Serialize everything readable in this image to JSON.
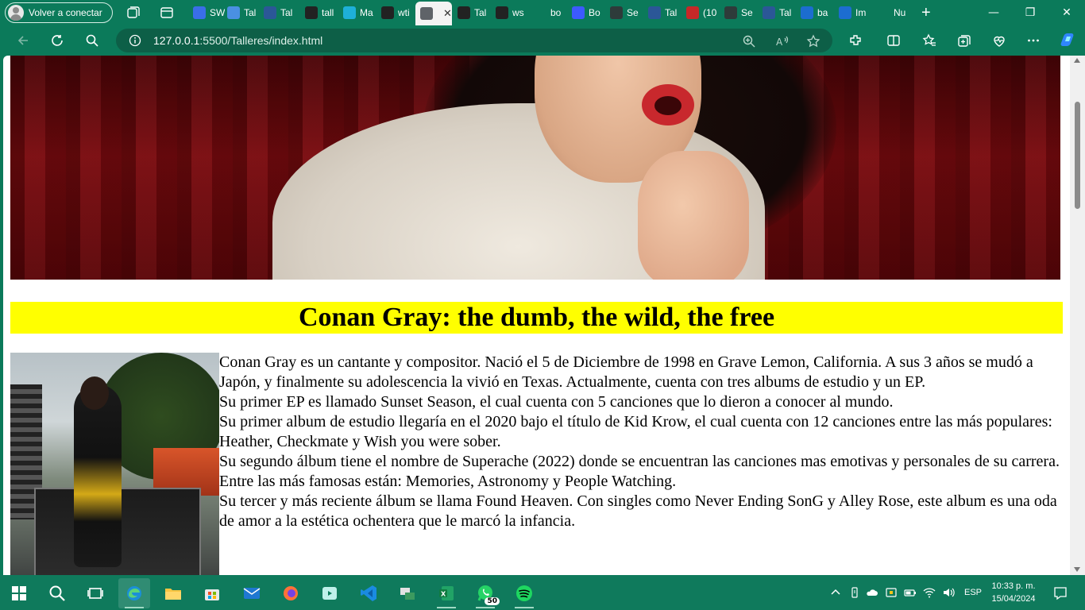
{
  "window": {
    "profile_label": "Volver a conectar",
    "tabs": [
      {
        "label": "SW",
        "color": "#3a6ee8"
      },
      {
        "label": "Tal",
        "color": "#4a90e2"
      },
      {
        "label": "Tal",
        "color": "#2b5797"
      },
      {
        "label": "tall",
        "color": "#222222"
      },
      {
        "label": "Ma",
        "color": "#1eb0d8"
      },
      {
        "label": "wti",
        "color": "#222222"
      },
      {
        "label": "",
        "color": "#5f6368",
        "active": true
      },
      {
        "label": "Tal",
        "color": "#222222"
      },
      {
        "label": "ws",
        "color": "#222222"
      },
      {
        "label": "bo",
        "color": "#0b7a5a"
      },
      {
        "label": "Bo",
        "color": "#3d5afe"
      },
      {
        "label": "Se",
        "color": "#2e3b3a"
      },
      {
        "label": "Tal",
        "color": "#2b5797"
      },
      {
        "label": "(10",
        "color": "#c62828"
      },
      {
        "label": "Se",
        "color": "#2e3b3a"
      },
      {
        "label": "Tal",
        "color": "#2b5797"
      },
      {
        "label": "ba",
        "color": "#1c6dd0"
      },
      {
        "label": "Im",
        "color": "#1c6dd0"
      },
      {
        "label": "Nu",
        "color": "#0b7a5a"
      }
    ],
    "tab_close_glyph": "✕",
    "new_tab_glyph": "+"
  },
  "address_bar": {
    "url_host": "127.0.0.1",
    "url_rest": ":5500/Talleres/index.html"
  },
  "page": {
    "heading": "Conan Gray: the dumb, the wild, the free",
    "paragraphs": [
      "Conan Gray es un cantante y compositor. Nació el 5 de Diciembre de 1998 en Grave Lemon, California. A sus 3 años se mudó a Japón, y finalmente su adolescencia la vivió en Texas. Actualmente, cuenta con tres albums de estudio y un EP.",
      "Su primer EP es llamado Sunset Season, el cual cuenta con 5 canciones que lo dieron a conocer al mundo.",
      "Su primer album de estudio llegaría en el 2020 bajo el título de Kid Krow, el cual cuenta con 12 canciones entre las más populares: Heather, Checkmate y Wish you were sober.",
      "Su segundo álbum tiene el nombre de Superache (2022) donde se encuentran las canciones mas emotivas y personales de su carrera. Entre las más famosas están: Memories, Astronomy y People Watching.",
      "Su tercer y más reciente álbum se llama Found Heaven. Con singles como Never Ending SonG y Alley Rose, este album es una oda de amor a la estética ochentera que le marcó la infancia."
    ]
  },
  "taskbar": {
    "whatsapp_badge": "50",
    "language": "ESP",
    "time": "10:33 p. m.",
    "date": "15/04/2024"
  },
  "colors": {
    "chrome": "#0b7a5a",
    "heading_bg": "#ffff00"
  }
}
